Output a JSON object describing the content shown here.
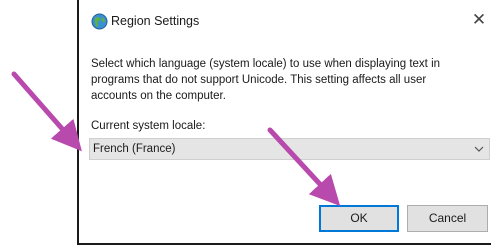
{
  "window": {
    "title": "Region Settings",
    "close_glyph": "✕",
    "icon": "globe-icon"
  },
  "description": "Select which language (system locale) to use when displaying text in programs that do not support Unicode. This setting affects all user accounts on the computer.",
  "locale": {
    "label": "Current system locale:",
    "selected_value": "French (France)",
    "chevron": "chevron-down-icon"
  },
  "buttons": {
    "ok_label": "OK",
    "cancel_label": "Cancel"
  },
  "annotations": {
    "arrow_color": "#b84aad"
  }
}
